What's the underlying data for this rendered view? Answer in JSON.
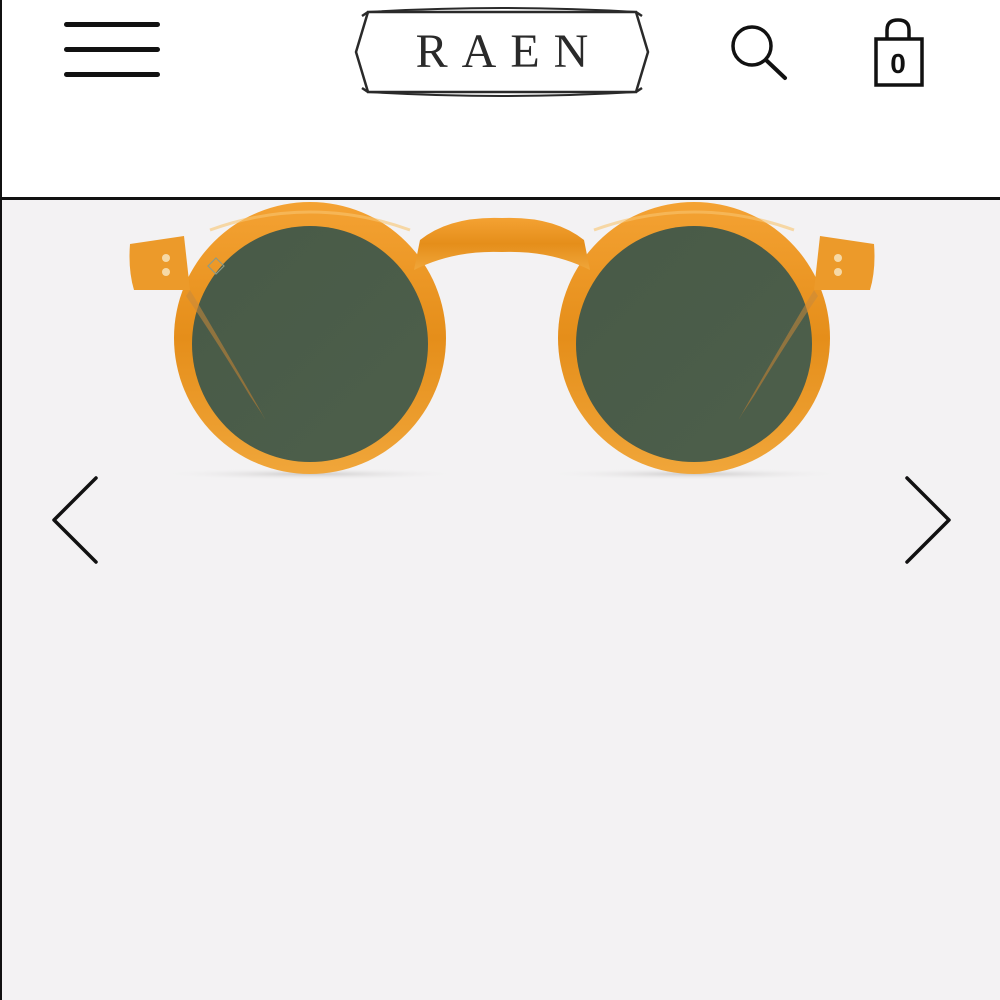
{
  "header": {
    "logo_text": "RAEN",
    "cart_count": "0",
    "icons": {
      "menu": "hamburger-menu-icon",
      "search": "search-icon",
      "cart": "shopping-bag-icon"
    }
  },
  "gallery": {
    "product_image": "amber-round-sunglasses-green-lens",
    "icons": {
      "prev": "chevron-left-icon",
      "next": "chevron-right-icon"
    }
  },
  "colors": {
    "text": "#111111",
    "gallery_background": "#f3f2f3",
    "frame_amber": "#e8941e",
    "lens_green": "#4a5a48"
  }
}
